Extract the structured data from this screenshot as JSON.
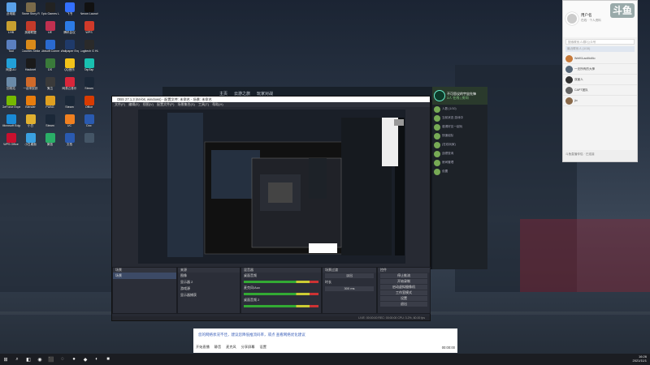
{
  "desktop": {
    "icons": [
      {
        "label": "此电脑",
        "color": "#5aa0e8"
      },
      {
        "label": "Stone Story RPG",
        "color": "#7a6a4a"
      },
      {
        "label": "Epic Games Launcher",
        "color": "#222222"
      },
      {
        "label": "飞书",
        "color": "#3370ff"
      },
      {
        "label": "Nexon Launcher",
        "color": "#111111"
      },
      {
        "label": "LHB",
        "color": "#c8a030"
      },
      {
        "label": "英雄联盟",
        "color": "#c33a2a"
      },
      {
        "label": "UE",
        "color": "#c03050"
      },
      {
        "label": "腾讯会议",
        "color": "#2c7be5"
      },
      {
        "label": "WPS",
        "color": "#d03a2a"
      },
      {
        "label": "Tool",
        "color": "#5a7fc0"
      },
      {
        "label": "Counter-Strike",
        "color": "#d88a1a"
      },
      {
        "label": "Ubisoft Connect",
        "color": "#2a6ad0"
      },
      {
        "label": "Wallpaper Engine",
        "color": "#1f3a6a"
      },
      {
        "label": "Logitech G HUB",
        "color": "#2a2a2a"
      },
      {
        "label": "网易UU",
        "color": "#22a0d8"
      },
      {
        "label": "Hacknet",
        "color": "#1a1a1a"
      },
      {
        "label": "DS",
        "color": "#3a7a3a"
      },
      {
        "label": "QQ音乐",
        "color": "#f2c31a"
      },
      {
        "label": "TapTap",
        "color": "#19c0b0"
      },
      {
        "label": "回收站",
        "color": "#6a8aa8"
      },
      {
        "label": "一起来捉妖",
        "color": "#d06a2a"
      },
      {
        "label": "鬼泣",
        "color": "#3a3a3a"
      },
      {
        "label": "网易云音乐",
        "color": "#d8263a"
      },
      {
        "label": "Steam",
        "color": "#1b2838"
      },
      {
        "label": "GeForce Experience",
        "color": "#76b900"
      },
      {
        "label": "Blender",
        "color": "#e87d0d"
      },
      {
        "label": "PUBG",
        "color": "#e0a020"
      },
      {
        "label": "Steam",
        "color": "#1b2838"
      },
      {
        "label": "Office",
        "color": "#d83b01"
      },
      {
        "label": "Microsoft Edge",
        "color": "#1a8ad6"
      },
      {
        "label": "小白",
        "color": "#e0b030"
      },
      {
        "label": "Steam",
        "color": "#1b2838"
      },
      {
        "label": "UC",
        "color": "#f08020"
      },
      {
        "label": "Doc",
        "color": "#2a5ab0"
      },
      {
        "label": "WPS Office",
        "color": "#c8102e"
      },
      {
        "label": "小白桌面",
        "color": "#3aa0e0"
      },
      {
        "label": "微信",
        "color": "#2aae67"
      },
      {
        "label": "文档",
        "color": "#2a5ab0"
      },
      {
        "label": "",
        "color": "#445566"
      }
    ]
  },
  "game_window": {
    "nav": [
      "主页",
      "云游之旅",
      "玩家对战"
    ],
    "room_title": "不可思议的宇宙先锋",
    "room_sub": "3人 在线 | 房间",
    "chat_lines": [
      "人数 (1/10)",
      "当前状态 游戏中",
      "邀请好友一起玩",
      "快速组队",
      "(在线玩家)",
      "战绩查询",
      "房间管理",
      "设置"
    ]
  },
  "obs": {
    "title": "OBS 27.1.3 (64-bit, windows) - 配置文件: 未命名 - 场景: 未命名",
    "menu": "文件(F) 编辑(E) 视图(V) 配置文件(P) 场景集合(S) 工具(T) 帮助(H)",
    "panels": {
      "scenes": {
        "title": "场景",
        "items": [
          "场景"
        ]
      },
      "sources": {
        "title": "来源",
        "items": [
          "图像",
          "显示器 2",
          "游戏源",
          "显示器捕获"
        ]
      },
      "mixer": {
        "title": "混音器",
        "tracks": [
          {
            "name": "桌面音频",
            "db": "0.0 dB"
          },
          {
            "name": "麦克风/Aux",
            "db": "0.0 dB"
          },
          {
            "name": "桌面音频 2",
            "db": "0.0 dB"
          }
        ]
      },
      "transitions": {
        "title": "场景过渡",
        "type": "淡出",
        "duration_label": "时长",
        "duration": "300 ms"
      },
      "controls": {
        "title": "控件",
        "buttons": [
          "停止推流",
          "开始录制",
          "启动虚拟摄像机",
          "工作室模式",
          "设置",
          "退出"
        ]
      }
    },
    "status": "LIVE: 00:00:00  REC: 00:00:00  CPU: 3.2%, 60.00 fps"
  },
  "dialog": {
    "text": "您的网络状况不佳，建议您降低推流码率，或点 查看网络优化建议",
    "bar_items": [
      "开始直播",
      "静音",
      "麦克风",
      "分享屏幕",
      "设置"
    ],
    "right": "00:00:00"
  },
  "chat": {
    "user_name": "用户名",
    "status": "在线 · 个人资料",
    "logo": "斗鱼",
    "search_placeholder": "搜索联系人/群/公众号",
    "section": "最近联系人 (1/15)",
    "contacts": [
      {
        "name": "WeiKILaoMoMo",
        "color": "#c77a3a"
      },
      {
        "name": "一无所有的大神",
        "color": "#556677"
      },
      {
        "name": "双面人",
        "color": "#333333"
      },
      {
        "name": "CAPT团队",
        "color": "#666666"
      },
      {
        "name": "jio",
        "color": "#8a6a4a"
      }
    ],
    "bottom": "斗鱼直播伴侣 · 已连接"
  },
  "taskbar": {
    "apps": [
      "⊞",
      "⌕",
      "◧",
      "◉",
      "⬛",
      "◌",
      "●",
      "◆",
      "◐",
      "■"
    ],
    "time": "16:26",
    "date": "2021/11/1"
  }
}
